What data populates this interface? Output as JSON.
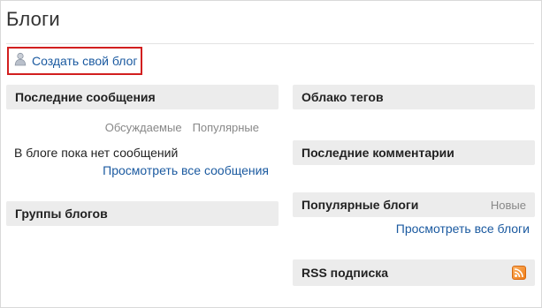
{
  "page": {
    "title": "Блоги",
    "create_blog_link": "Создать свой блог"
  },
  "left": {
    "latest_messages": {
      "title": "Последние сообщения",
      "tabs": [
        "Обсуждаемые",
        "Популярные"
      ],
      "empty_text": "В блоге пока нет сообщений",
      "view_all_link": "Просмотреть все сообщения"
    },
    "blog_groups": {
      "title": "Группы блогов"
    }
  },
  "right": {
    "tag_cloud": {
      "title": "Облако тегов"
    },
    "latest_comments": {
      "title": "Последние комментарии"
    },
    "popular_blogs": {
      "title": "Популярные блоги",
      "tab": "Новые",
      "view_all_link": "Просмотреть все блоги"
    },
    "rss": {
      "title": "RSS подписка",
      "icon": "rss-icon"
    }
  },
  "colors": {
    "link": "#1b5aa0",
    "highlight_border": "#d21f1f",
    "panel_header_bg": "#ececec",
    "rss_orange": "#f07c16"
  }
}
